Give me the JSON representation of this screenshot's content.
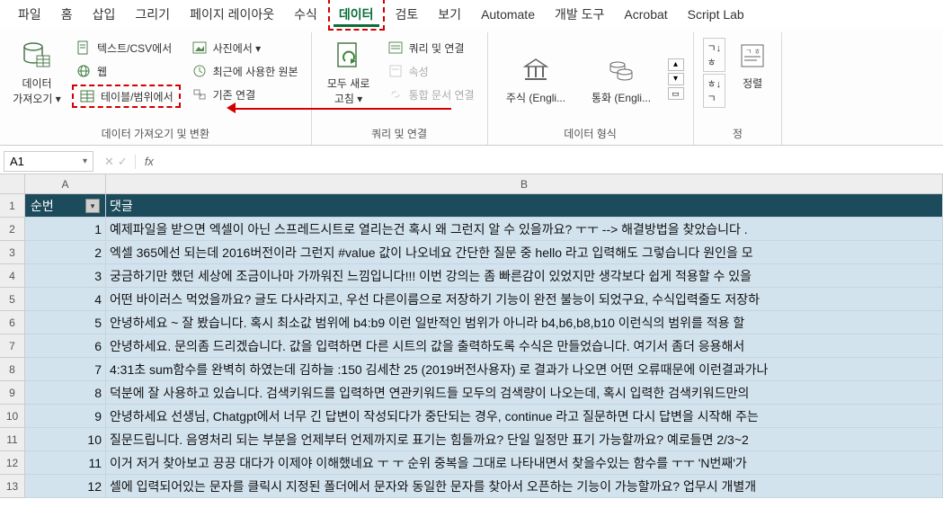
{
  "menu": {
    "items": [
      "파일",
      "홈",
      "삽입",
      "그리기",
      "페이지 레이아웃",
      "수식",
      "데이터",
      "검토",
      "보기",
      "Automate",
      "개발 도구",
      "Acrobat",
      "Script Lab"
    ],
    "highlighted_index": 6
  },
  "ribbon": {
    "group1": {
      "title": "데이터 가져오기 및 변환",
      "import_btn": "데이터\n가져오기 ▾",
      "text_csv": "텍스트/CSV에서",
      "web": "웹",
      "table_range": "테이블/범위에서",
      "photo": "사진에서 ▾",
      "recent": "최근에 사용한 원본",
      "existing": "기존 연결"
    },
    "group2": {
      "title": "쿼리 및 연결",
      "refresh": "모두 새로\n고침 ▾",
      "queries": "쿼리 및 연결",
      "properties": "속성",
      "links": "통합 문서 연결"
    },
    "group3": {
      "title": "데이터 형식",
      "stocks": "주식 (Engli...",
      "currency": "통화 (Engli..."
    },
    "group4": {
      "title": "정",
      "sort_asc": "긱↓",
      "sort_desc": "흑↓",
      "sort": "정렬"
    }
  },
  "namebox": "A1",
  "formula": "",
  "columns": [
    "A",
    "B"
  ],
  "header": {
    "a": "순번",
    "b": "댓글"
  },
  "rows": [
    {
      "n": 1,
      "a": "1",
      "b": "예제파일을 받으면 엑셀이 아닌 스프레드시트로 열리는건 혹시 왜 그런지 알 수 있을까요? ㅜㅜ  --> 해결방법을 찾았습니다 ."
    },
    {
      "n": 2,
      "a": "2",
      "b": "엑셀 365에선 되는데 2016버전이라 그런지 #value 값이 나오네요   간단한 질문 중 hello 라고 입력해도 그렇습니다  원인을 모"
    },
    {
      "n": 3,
      "a": "3",
      "b": "궁금하기만 했던 세상에 조금이나마 가까워진 느낌입니다!!! 이번 강의는 좀 빠른감이 있었지만 생각보다 쉽게 적용할 수 있을"
    },
    {
      "n": 4,
      "a": "4",
      "b": "어떤 바이러스 먹었을까요? 글도 다사라지고, 우선 다른이름으로 저장하기 기능이 완전 불능이 되었구요, 수식입력줄도 저장하"
    },
    {
      "n": 5,
      "a": "5",
      "b": "안녕하세요 ~ 잘 봤습니다.    혹시 최소값 범위에 b4:b9 이런 일반적인 범위가 아니라 b4,b6,b8,b10 이런식의 범위를 적용 할"
    },
    {
      "n": 6,
      "a": "6",
      "b": "안녕하세요. 문의좀 드리겠습니다.  값을 입력하면 다른 시트의 값을 출력하도록 수식은 만들었습니다.  여기서 좀더 응용해서 "
    },
    {
      "n": 7,
      "a": "7",
      "b": "4:31초 sum함수를 완벽히 하였는데 김하늘 :150  김세찬 25 (2019버전사용자) 로 결과가 나오면 어떤 오류때문에 이런결과가나"
    },
    {
      "n": 8,
      "a": "8",
      "b": "덕분에 잘 사용하고 있습니다.  검색키워드를 입력하면 연관키워드들 모두의 검색량이 나오는데,  혹시 입력한 검색키워드만의"
    },
    {
      "n": 9,
      "a": "9",
      "b": "안녕하세요 선생님, Chatgpt에서 너무 긴 답변이 작성되다가 중단되는 경우, continue 라고 질문하면 다시 답변을 시작해 주는"
    },
    {
      "n": 10,
      "a": "10",
      "b": "질문드립니다. 음영처리 되는 부분을 언제부터 언제까지로 표기는 힘들까요?  단일 일정만 표기 가능할까요? 예로들면   2/3~2"
    },
    {
      "n": 11,
      "a": "11",
      "b": "이거 저거 찾아보고 끙끙 대다가 이제야 이해했네요 ㅜ ㅜ 순위 중복을 그대로 나타내면서 찾을수있는 함수를 ㅜㅜ 'N번째'가 "
    },
    {
      "n": 12,
      "a": "12",
      "b": "셀에 입력되어있는 문자를 클릭시 지정된 폴더에서 문자와 동일한 문자를 찾아서 오픈하는 기능이 가능할까요? 업무시 개별개"
    }
  ]
}
